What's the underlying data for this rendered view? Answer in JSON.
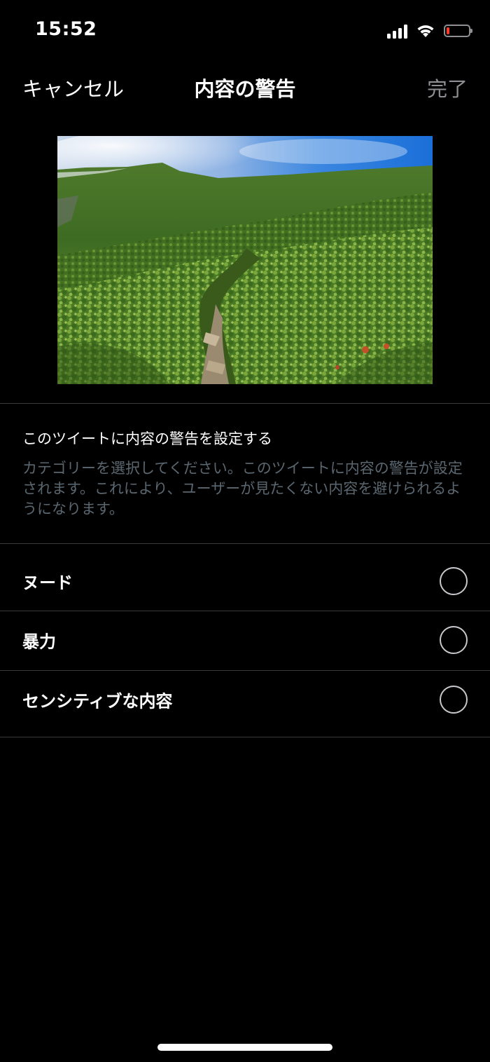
{
  "status_bar": {
    "time": "15:52",
    "icons": [
      "cellular-signal-icon",
      "wifi-icon",
      "battery-low-icon"
    ],
    "battery_level_fraction": 0.1,
    "battery_color": "#ff3b30"
  },
  "nav": {
    "cancel_label": "キャンセル",
    "title": "内容の警告",
    "done_label": "完了",
    "done_color": "#8e8e93"
  },
  "preview_image": {
    "subject": "mountain-meadow-trail-photo"
  },
  "info": {
    "title": "このツイートに内容の警告を設定する",
    "description": "カテゴリーを選択してください。このツイートに内容の警告が設定されます。これにより、ユーザーが見たくない内容を避けられるようになります。",
    "description_color": "#5b6770"
  },
  "options": [
    {
      "label": "ヌード",
      "selected": false
    },
    {
      "label": "暴力",
      "selected": false
    },
    {
      "label": "センシティブな内容",
      "selected": false
    }
  ]
}
